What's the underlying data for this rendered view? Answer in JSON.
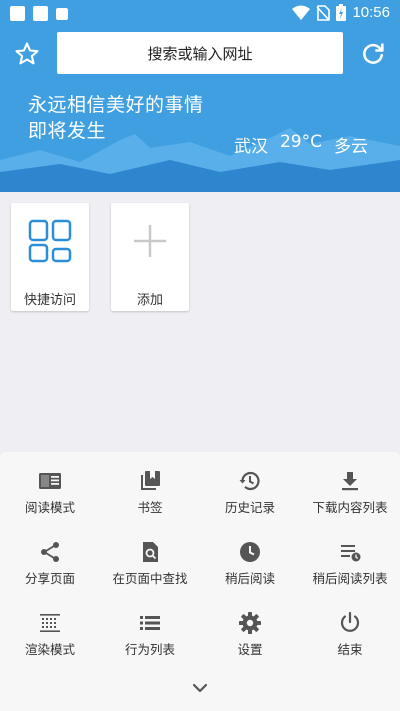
{
  "status_bar": {
    "time": "10:56"
  },
  "search": {
    "placeholder": "搜索或输入网址"
  },
  "hero": {
    "slogan_line1": "永远相信美好的事情",
    "slogan_line2": "即将发生",
    "city": "武汉",
    "temperature": "29°C",
    "condition": "多云"
  },
  "tiles": [
    {
      "label": "快捷访问",
      "icon": "grid-icon"
    },
    {
      "label": "添加",
      "icon": "plus-icon"
    }
  ],
  "menu": {
    "items": [
      {
        "label": "阅读模式",
        "icon": "reader-mode-icon"
      },
      {
        "label": "书签",
        "icon": "bookmarks-icon"
      },
      {
        "label": "历史记录",
        "icon": "history-icon"
      },
      {
        "label": "下载内容列表",
        "icon": "download-icon"
      },
      {
        "label": "分享页面",
        "icon": "share-icon"
      },
      {
        "label": "在页面中查找",
        "icon": "find-in-page-icon"
      },
      {
        "label": "稍后阅读",
        "icon": "clock-icon"
      },
      {
        "label": "稍后阅读列表",
        "icon": "read-later-list-icon"
      },
      {
        "label": "渲染模式",
        "icon": "render-mode-icon"
      },
      {
        "label": "行为列表",
        "icon": "list-icon"
      },
      {
        "label": "设置",
        "icon": "gear-icon"
      },
      {
        "label": "结束",
        "icon": "power-icon"
      }
    ]
  },
  "colors": {
    "hero_blue": "#3f9fe0",
    "accent_blue": "#2a8fd8",
    "icon_gray": "#555555"
  }
}
